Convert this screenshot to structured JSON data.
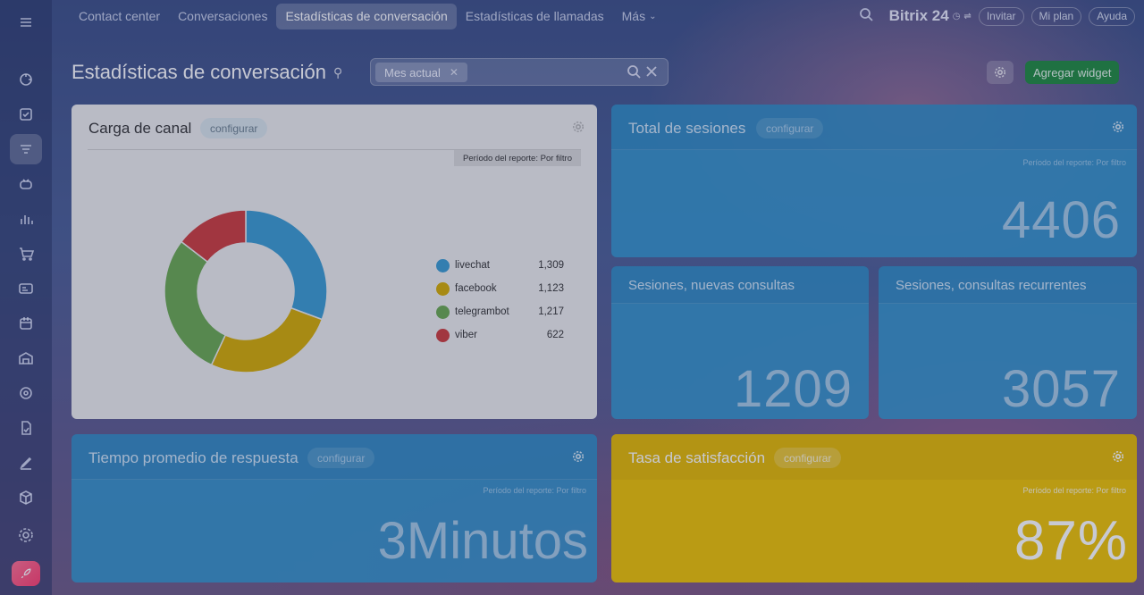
{
  "topnav": {
    "items": [
      "Contact center",
      "Conversaciones",
      "Estadísticas de conversación",
      "Estadísticas de llamadas",
      "Más"
    ],
    "active_index": 2
  },
  "header": {
    "brand": "Bitrix 24",
    "invite": "Invitar",
    "my_plan": "Mi plan",
    "help": "Ayuda"
  },
  "page": {
    "title": "Estadísticas de conversación",
    "filter_tag": "Mes actual",
    "add_widget": "Agregar widget"
  },
  "widgets": {
    "channel_load": {
      "title": "Carga de canal",
      "configure": "configurar",
      "period": "Período del reporte: Por filtro",
      "legend": [
        {
          "name": "livechat",
          "value": "1,309",
          "color": "#3a9bd0"
        },
        {
          "name": "facebook",
          "value": "1,123",
          "color": "#d4ab00"
        },
        {
          "name": "telegrambot",
          "value": "1,217",
          "color": "#6aa84f"
        },
        {
          "name": "viber",
          "value": "622",
          "color": "#cc3b3b"
        }
      ]
    },
    "total_sessions": {
      "title": "Total de sesiones",
      "configure": "configurar",
      "period": "Período del reporte: Por filtro",
      "value": "4406"
    },
    "new_sessions": {
      "title": "Sesiones, nuevas consultas",
      "value": "1209"
    },
    "repeat_sessions": {
      "title": "Sesiones, consultas recurrentes",
      "value": "3057"
    },
    "avg_response": {
      "title": "Tiempo promedio de respuesta",
      "configure": "configurar",
      "period": "Período del reporte: Por filtro",
      "value": "3Minutos"
    },
    "satisfaction": {
      "title": "Tasa de satisfacción",
      "configure": "configurar",
      "period": "Período del reporte: Por filtro",
      "value": "87%"
    }
  },
  "chart_data": {
    "type": "pie",
    "categories": [
      "livechat",
      "facebook",
      "telegrambot",
      "viber"
    ],
    "values": [
      1309,
      1123,
      1217,
      622
    ],
    "colors": [
      "#3a9bd0",
      "#d4ab00",
      "#6aa84f",
      "#cc3b3b"
    ],
    "donut": true,
    "legend": "right"
  }
}
